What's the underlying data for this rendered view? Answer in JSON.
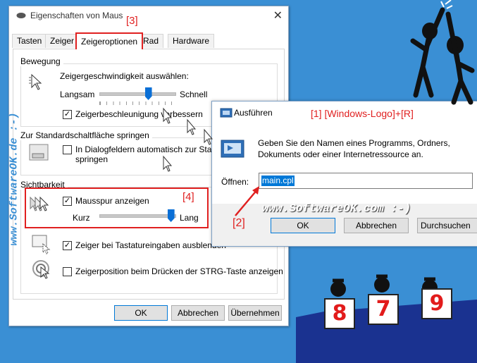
{
  "dialog": {
    "title": "Eigenschaften von Maus",
    "tabs": [
      "Tasten",
      "Zeiger",
      "Zeigeroptionen",
      "Rad",
      "Hardware"
    ],
    "active_tab": "Zeigeroptionen",
    "motion": {
      "group_label": "Bewegung",
      "speed_label": "Zeigergeschwindigkeit auswählen:",
      "slow": "Langsam",
      "fast": "Schnell",
      "speed_value_fraction": 0.65,
      "precision_label": "Zeigerbeschleunigung verbessern",
      "precision_checked": true
    },
    "snapto": {
      "group_label": "Zur Standardschaltfläche springen",
      "label_line1": "In Dialogfeldern automatisch zur Standards",
      "label_line2": "springen",
      "checked": false
    },
    "visibility": {
      "group_label": "Sichtbarkeit",
      "trails_label": "Mausspur anzeigen",
      "trails_checked": true,
      "short": "Kurz",
      "long": "Lang",
      "trail_value_fraction": 0.95,
      "hide_label": "Zeiger bei Tastatureingaben ausblenden",
      "hide_checked": true,
      "ctrl_label": "Zeigerposition beim Drücken der STRG-Taste anzeigen",
      "ctrl_checked": false
    },
    "buttons": {
      "ok": "OK",
      "cancel": "Abbrechen",
      "apply": "Übernehmen"
    }
  },
  "run_dialog": {
    "title": "Ausführen",
    "hotkey_note": "[1] [Windows-Logo]+[R]",
    "description_line1": "Geben Sie den Namen eines Programms, Ordners,",
    "description_line2": "Dokuments oder einer Internetressource an.",
    "open_label": "Öffnen:",
    "open_value": "main.cpl",
    "buttons": {
      "ok": "OK",
      "cancel": "Abbrechen",
      "browse": "Durchsuchen"
    }
  },
  "annotations": {
    "tab_marker": "[3]",
    "trails_marker": "[4]",
    "input_marker": "[2]"
  },
  "watermark": {
    "bottom": "www.SoftwareOK.com :-)",
    "vertical": "www.SoftwareOK.de :-)"
  },
  "cards": [
    "8",
    "7",
    "9"
  ],
  "colors": {
    "accent": "#0078d7",
    "highlight_red": "#e02020",
    "background": "#3a8fd4"
  }
}
